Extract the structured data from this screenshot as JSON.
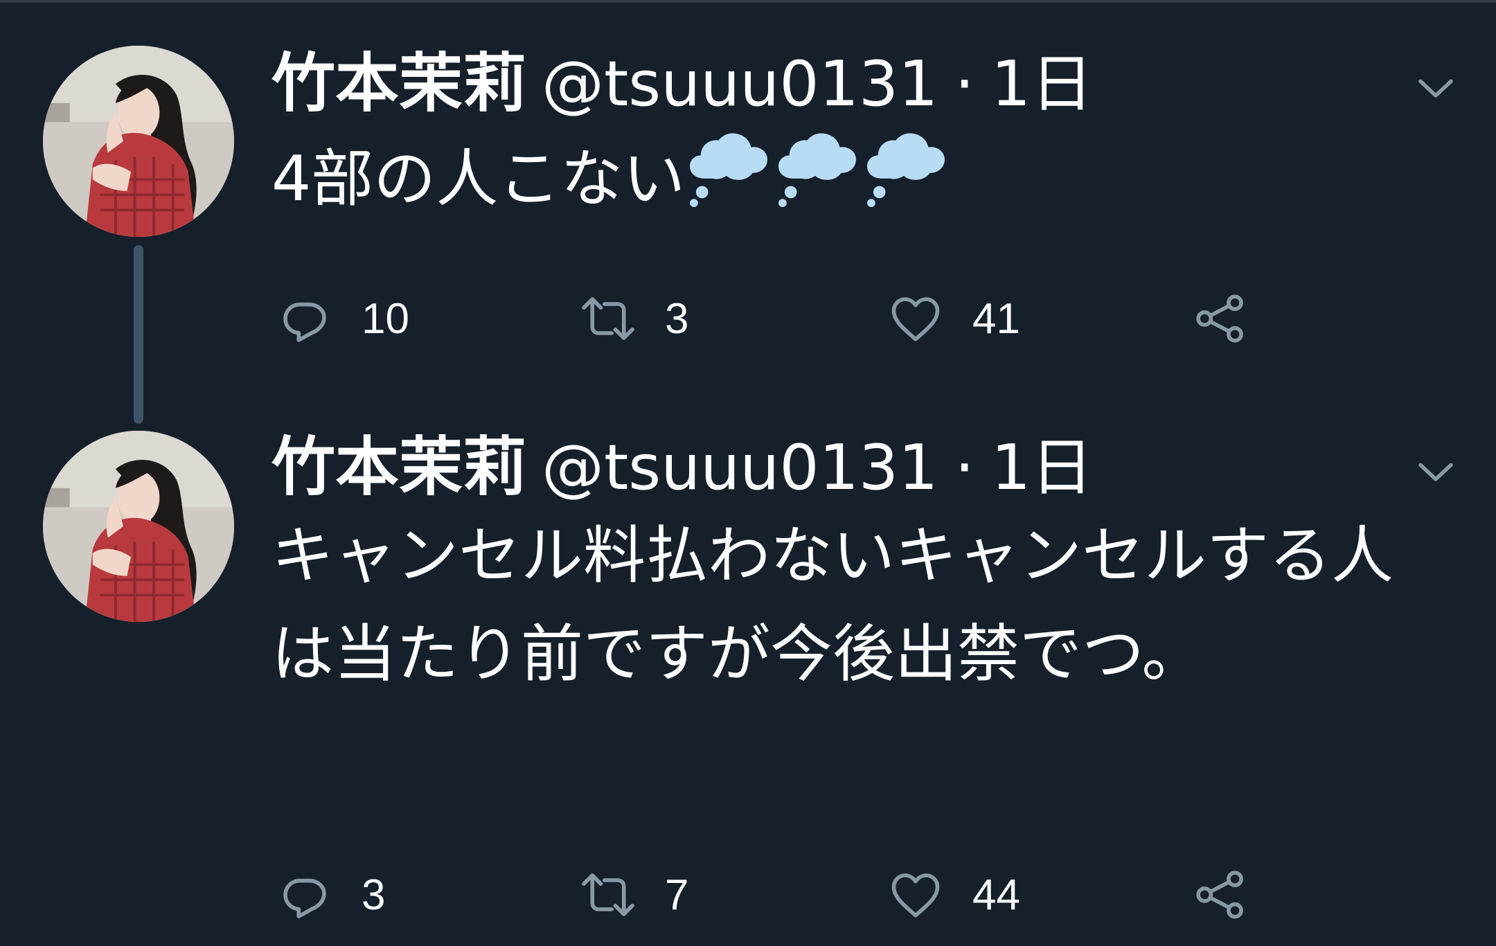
{
  "colors": {
    "background": "#15202b",
    "icon": "#8899a6",
    "thread_line": "#3d5466",
    "emoji": "#b9dcf5"
  },
  "tweets": [
    {
      "name": "竹本茉莉",
      "handle": "@tsuuu0131",
      "separator": "·",
      "time": "1日",
      "text": "4部の人こない",
      "emoji": [
        "thought-balloon",
        "thought-balloon",
        "thought-balloon"
      ],
      "replies": "10",
      "retweets": "3",
      "likes": "41"
    },
    {
      "name": "竹本茉莉",
      "handle": "@tsuuu0131",
      "separator": "·",
      "time": "1日",
      "text": "キャンセル料払わないキャンセルする人は当たり前ですが今後出禁でつ。",
      "replies": "3",
      "retweets": "7",
      "likes": "44"
    }
  ],
  "icons": {
    "reply": "reply-icon",
    "retweet": "retweet-icon",
    "like": "heart-icon",
    "share": "share-icon",
    "menu": "chevron-down-icon"
  }
}
